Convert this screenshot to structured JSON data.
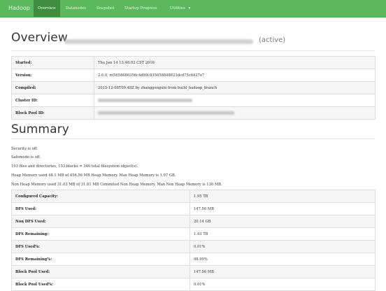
{
  "navbar": {
    "brand": "Hadoop",
    "items": [
      {
        "label": "Overview",
        "active": true
      },
      {
        "label": "Datanodes",
        "active": false
      },
      {
        "label": "Snapshot",
        "active": false
      },
      {
        "label": "Startup Progress",
        "active": false
      },
      {
        "label": "Utilities",
        "active": false
      }
    ],
    "dropdown_caret": "▾"
  },
  "overview": {
    "title": "Overview",
    "status": "(active)",
    "rows": [
      {
        "label": "Started:",
        "value": "Thu Jan 14 13:48:02 CST 2016"
      },
      {
        "label": "Version:",
        "value": "2.6.0, re5658686356c4d89c835658848623dcd75c6427e7"
      },
      {
        "label": "Compiled:",
        "value": "2015-12-08T09:48Z by zhanggengxin from build_hadoop_branch"
      },
      {
        "label": "Cluster ID:",
        "value": ""
      },
      {
        "label": "Block Pool ID:",
        "value": ""
      }
    ]
  },
  "summary": {
    "title": "Summary",
    "lines": [
      "Security is off.",
      "Safemode is off.",
      "193 files and directories, 153 blocks = 346 total filesystem object(s).",
      "Heap Memory used 48.1 MB of 456.56 MB Heap Memory. Max Heap Memory is 1.97 GB.",
      "Non Heap Memory used 31.03 MB of 31.81 MB Commited Non Heap Memory. Max Non Heap Memory is 130 MB."
    ],
    "rows": [
      {
        "label": "Configured Capacity:",
        "value": "1.95 TB"
      },
      {
        "label": "DFS Used:",
        "value": "147.56 MB"
      },
      {
        "label": "Non DFS Used:",
        "value": "20.14 GB"
      },
      {
        "label": "DFS Remaining:",
        "value": "1.93 TB"
      },
      {
        "label": "DFS Used%:",
        "value": "0.01%"
      },
      {
        "label": "DFS Remaining%:",
        "value": "98.99%"
      },
      {
        "label": "Block Pool Used:",
        "value": "147.56 MB"
      },
      {
        "label": "Block Pool Used%:",
        "value": "0.01%"
      }
    ]
  },
  "colors": {
    "navbar": "#5cb85c",
    "nav_active": "#3f8c3f"
  }
}
